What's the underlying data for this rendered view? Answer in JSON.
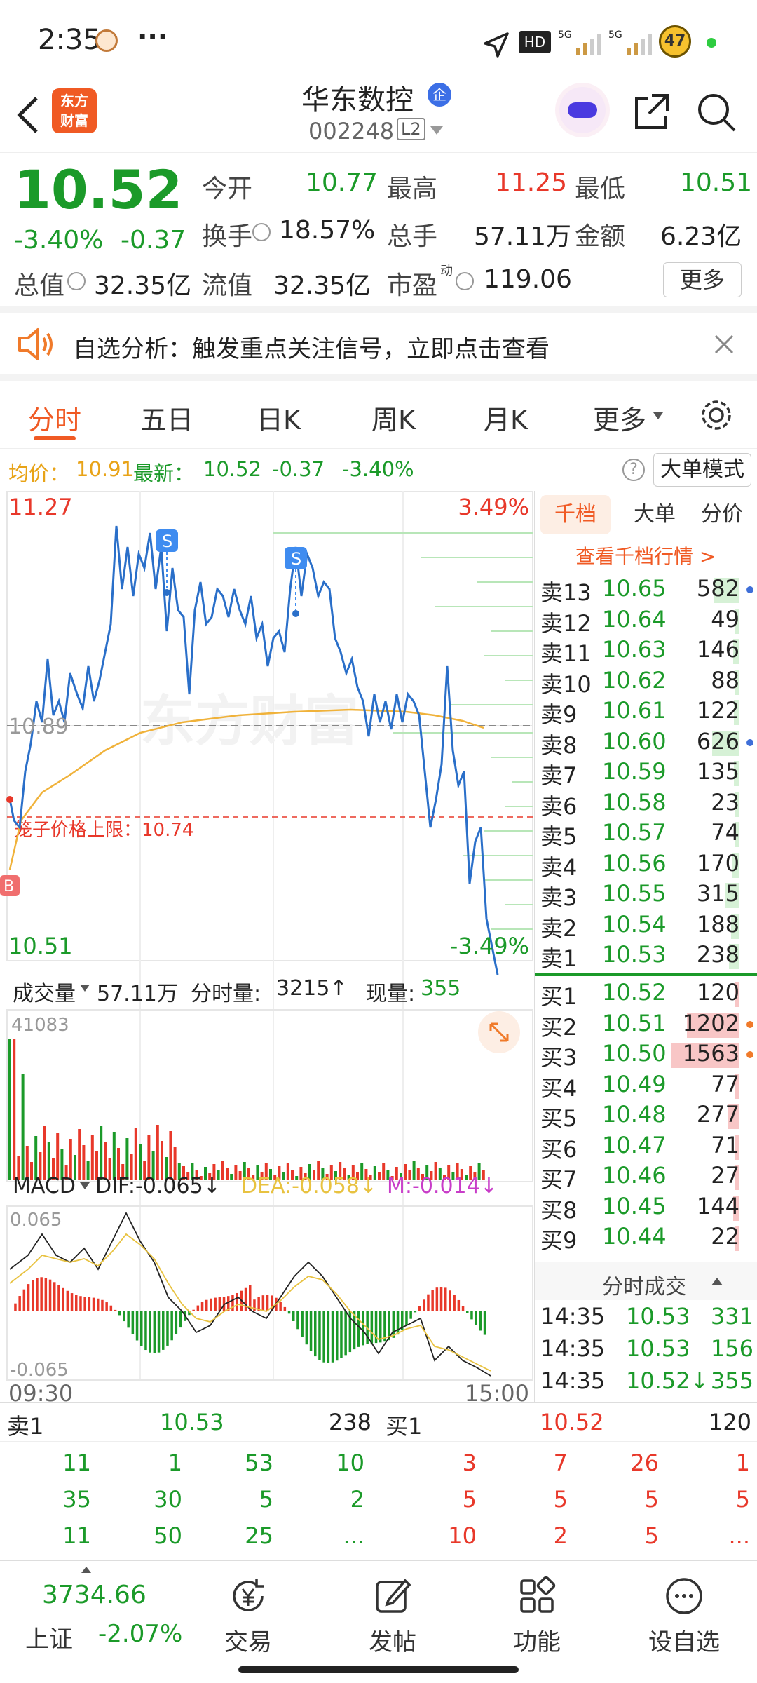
{
  "status_bar": {
    "time": "2:35",
    "more": "···",
    "battery": "47"
  },
  "header": {
    "logo_line1": "东方",
    "logo_line2": "财富",
    "stock_name": "华东数控",
    "stock_code": "002248",
    "level": "L2",
    "tag": "企"
  },
  "quote": {
    "price": "10.52",
    "change_pct": "-3.40%",
    "change": "-0.37",
    "open_label": "今开",
    "open": "10.77",
    "high_label": "最高",
    "high": "11.25",
    "low_label": "最低",
    "low": "10.51",
    "turnover_label": "换手",
    "turnover": "18.57%",
    "volume_label": "总手",
    "volume": "57.11万",
    "amount_label": "金额",
    "amount": "6.23亿",
    "mktcap_label": "总值",
    "mktcap": "32.35亿",
    "float_label": "流值",
    "float_cap": "32.35亿",
    "pe_label": "市盈",
    "pe_sup": "动",
    "pe": "119.06",
    "more_button": "更多"
  },
  "banner": {
    "text": "自选分析：触发重点关注信号，立即点击查看"
  },
  "tabs": [
    "分时",
    "五日",
    "日K",
    "周K",
    "月K",
    "更多"
  ],
  "infobar": {
    "avg_label": "均价：",
    "avg": "10.91",
    "latest_label": "最新：",
    "latest": "10.52",
    "chg": "-0.37",
    "chg_pct": "-3.40%",
    "mode_button": "大单模式"
  },
  "chart": {
    "y_top": "11.27",
    "y_bottom": "10.51",
    "pct_top": "3.49%",
    "pct_bottom": "-3.49%",
    "mid_label": "10.89",
    "limit_text": "笼子价格上限：10.74",
    "watermark": "东方财富",
    "marker_s": "S",
    "marker_b": "B",
    "vol_label": "成交量",
    "vol_total": "57.11万",
    "vol_fen_label": "分时量:",
    "vol_fen": "3215↑",
    "vol_now_label": "现量:",
    "vol_now": "355",
    "vol_max": "41083",
    "macd_label": "MACD",
    "dif": "DIF:-0.065↓",
    "dea": "DEA:-0.058↓",
    "m": "M:-0.014↓",
    "macd_top": "0.065",
    "macd_bottom": "-0.065",
    "time_start": "09:30",
    "time_end": "15:00"
  },
  "book_tabs": [
    "千档",
    "大单",
    "分价"
  ],
  "book_link": "查看千档行情 >",
  "asks": [
    {
      "label": "卖13",
      "price": "10.65",
      "vol": "582"
    },
    {
      "label": "卖12",
      "price": "10.64",
      "vol": "49"
    },
    {
      "label": "卖11",
      "price": "10.63",
      "vol": "146"
    },
    {
      "label": "卖10",
      "price": "10.62",
      "vol": "88"
    },
    {
      "label": "卖9",
      "price": "10.61",
      "vol": "122"
    },
    {
      "label": "卖8",
      "price": "10.60",
      "vol": "626"
    },
    {
      "label": "卖7",
      "price": "10.59",
      "vol": "135"
    },
    {
      "label": "卖6",
      "price": "10.58",
      "vol": "23"
    },
    {
      "label": "卖5",
      "price": "10.57",
      "vol": "74"
    },
    {
      "label": "卖4",
      "price": "10.56",
      "vol": "170"
    },
    {
      "label": "卖3",
      "price": "10.55",
      "vol": "315"
    },
    {
      "label": "卖2",
      "price": "10.54",
      "vol": "188"
    },
    {
      "label": "卖1",
      "price": "10.53",
      "vol": "238"
    }
  ],
  "bids": [
    {
      "label": "买1",
      "price": "10.52",
      "vol": "120"
    },
    {
      "label": "买2",
      "price": "10.51",
      "vol": "1202"
    },
    {
      "label": "买3",
      "price": "10.50",
      "vol": "1563"
    },
    {
      "label": "买4",
      "price": "10.49",
      "vol": "77"
    },
    {
      "label": "买5",
      "price": "10.48",
      "vol": "277"
    },
    {
      "label": "买6",
      "price": "10.47",
      "vol": "71"
    },
    {
      "label": "买7",
      "price": "10.46",
      "vol": "27"
    },
    {
      "label": "买8",
      "price": "10.45",
      "vol": "144"
    },
    {
      "label": "买9",
      "price": "10.44",
      "vol": "22"
    }
  ],
  "trades_title": "分时成交",
  "trades": [
    {
      "time": "14:35",
      "price": "10.53",
      "vol": "331"
    },
    {
      "time": "14:35",
      "price": "10.53",
      "vol": "156"
    },
    {
      "time": "14:35",
      "price": "10.52↓",
      "vol": "355"
    }
  ],
  "levels": {
    "ask_label": "卖1",
    "ask_price": "10.53",
    "ask_vol": "238",
    "bid_label": "买1",
    "bid_price": "10.52",
    "bid_vol": "120",
    "ask_queue": [
      [
        "11",
        "1",
        "53",
        "10"
      ],
      [
        "35",
        "30",
        "5",
        "2"
      ],
      [
        "11",
        "50",
        "25",
        "..."
      ]
    ],
    "bid_queue": [
      [
        "3",
        "7",
        "26",
        "1"
      ],
      [
        "5",
        "5",
        "5",
        "5"
      ],
      [
        "10",
        "2",
        "5",
        "..."
      ]
    ]
  },
  "bottom_nav": {
    "index_value": "3734.66",
    "index_name": "上证",
    "index_chg": "-2.07%",
    "items": [
      "交易",
      "发帖",
      "功能",
      "设自选"
    ]
  }
}
